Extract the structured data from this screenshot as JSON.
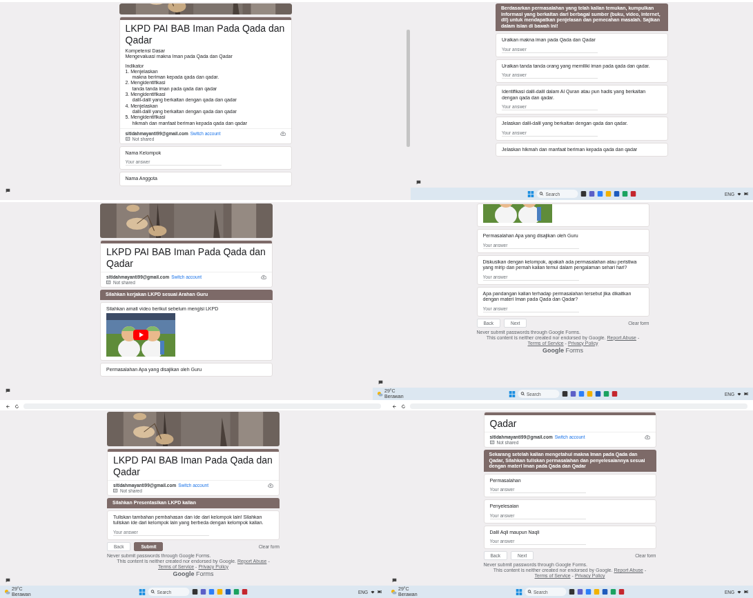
{
  "panels": [
    {
      "cards": [
        {
          "kind": "banner_strip"
        },
        {
          "kind": "title",
          "title": "LKPD PAI BAB Iman Pada Qada dan Qadar",
          "email": "sitidahmayanti99@gmail.com",
          "switch": "Switch account",
          "shared": "Not shared",
          "description": [
            {
              "kind": "line",
              "text": "Kompetensi Dasar"
            },
            {
              "kind": "line",
              "text": "Mengevaluasi makna Iman pada Qada dan Qadar"
            },
            {
              "kind": "gap"
            },
            {
              "kind": "line",
              "text": "Indikator"
            },
            {
              "kind": "line",
              "text": "1. Menjelaskan"
            },
            {
              "kind": "sub",
              "text": "makna beriman kepada qada dan qadar."
            },
            {
              "kind": "line",
              "text": "2. Mengidentifikasi"
            },
            {
              "kind": "sub",
              "text": "tanda tanda iman pada qada dan qadar"
            },
            {
              "kind": "line",
              "text": "3. Mengidentifikasi"
            },
            {
              "kind": "sub",
              "text": "dalil-dalil yang berkaitan dengan qada dan qadar"
            },
            {
              "kind": "line",
              "text": "4. Menjelaskan"
            },
            {
              "kind": "sub",
              "text": "dalil-dalil yang berkaitan dengan qada dan qadar"
            },
            {
              "kind": "line",
              "text": "5. Mengidentifikasi"
            },
            {
              "kind": "sub",
              "text": "hikmah dan manfaat beriman kepada qada dan qadar"
            }
          ]
        },
        {
          "kind": "question",
          "label": "Nama Kelompok",
          "placeholder": "Your answer"
        },
        {
          "kind": "question",
          "label": "Nama Anggota"
        }
      ]
    },
    {
      "taskbar": {
        "search": "Search",
        "lang": "ENG"
      },
      "cards": [
        {
          "kind": "section",
          "text": "Berdasarkan permasalahan yang telah kalian temukan, kumpulkan informasi yang berkaitan dari berbagai sumber (buku, video, internet, dll) untuk mendapatkan penjelasan dan pemecahan masalah. Sajikan dalam isian di bawah ini!"
        },
        {
          "kind": "question",
          "label": "Uraikan makna  iman pada Qada dan Qadar",
          "placeholder": "Your answer"
        },
        {
          "kind": "question",
          "label": "Uraikan tanda tanda orang yang memiliki iman pada qada dan qadar.",
          "placeholder": "Your answer"
        },
        {
          "kind": "question",
          "label": "Identifikasi dalil-dalil dalam Al Quran atau pun hadis yang berkaitan dengan qada dan qadar.",
          "placeholder": "Your answer"
        },
        {
          "kind": "question",
          "label": "Jelaskan dalil-dalil yang berkaitan dengan qada dan qadar.",
          "placeholder": "Your answer"
        },
        {
          "kind": "question",
          "label": "Jelaskan hikmah dan manfaat beriman kepada qada dan qadar"
        }
      ]
    },
    {
      "cards": [
        {
          "kind": "banner"
        },
        {
          "kind": "title",
          "title": "LKPD PAI BAB Iman Pada Qada dan Qadar",
          "email": "sitidahmayanti99@gmail.com",
          "switch": "Switch account",
          "shared": "Not shared"
        },
        {
          "kind": "section",
          "text": "Silahkan kerjakan LKPD sesuai Arahan Guru"
        },
        {
          "kind": "video",
          "text": "Silahkan amati video berikut sebelum mengisi LKPD"
        },
        {
          "kind": "question",
          "label": "Permasalahan Apa yang disajikan oleh Guru"
        }
      ]
    },
    {
      "taskbar": {
        "weather": {
          "temp": "29°C",
          "label": "Berawan"
        },
        "search": "Search",
        "lang": "ENG"
      },
      "cards": [
        {
          "kind": "video_tail"
        },
        {
          "kind": "question",
          "label": "Permasalahan Apa yang disajikan oleh Guru",
          "placeholder": "Your answer"
        },
        {
          "kind": "question",
          "label": "Diskusikan dengan kelompok, apakah ada permasalahan  atau peristiwa yang mirip dan pernah kalian temui dalam pengalaman sehari hari?",
          "placeholder": "Your answer"
        },
        {
          "kind": "question",
          "label": "Apa pandangan kalian terhadap permasalahan tersebut jika dikaitkan dengan materi Iman pada Qada dan Qadar?",
          "placeholder": "Your answer"
        },
        {
          "kind": "nav",
          "buttons": [
            {
              "label": "Back",
              "kind": "outline"
            },
            {
              "label": "Next",
              "kind": "outline"
            }
          ],
          "clear": "Clear form"
        },
        {
          "kind": "footer",
          "note": "Never submit passwords through Google Forms.",
          "disclaimer": "This content is neither created nor endorsed by Google.",
          "links": [
            "Report Abuse",
            "Terms of Service",
            "Privacy Policy"
          ],
          "separator": "-",
          "logo": {
            "brand": "Google",
            "product": "Forms"
          }
        }
      ]
    },
    {
      "top_bar": {
        "kind": "address"
      },
      "taskbar": {
        "weather": {
          "temp": "29°C",
          "label": "Berawan"
        },
        "search": "Search",
        "lang": "ENG"
      },
      "cards": [
        {
          "kind": "banner"
        },
        {
          "kind": "title",
          "title": "LKPD PAI BAB Iman Pada Qada dan Qadar",
          "email": "sitidahmayanti99@gmail.com",
          "switch": "Switch account",
          "shared": "Not shared"
        },
        {
          "kind": "section",
          "text": "Silahkan Presentasikan LKPD kalian"
        },
        {
          "kind": "question",
          "label": "Tuliskan tambahan pembahasan dan ide dari kelompok lain! Silahkan tuliskan ide dari kelompok lain yang berbeda dengan kelompok kalian.",
          "placeholder": "Your answer"
        },
        {
          "kind": "nav",
          "buttons": [
            {
              "label": "Back",
              "kind": "outline"
            },
            {
              "label": "Submit",
              "kind": "filled"
            }
          ],
          "clear": "Clear form"
        },
        {
          "kind": "footer",
          "note": "Never submit passwords through Google Forms.",
          "disclaimer": "This content is neither created nor endorsed by Google.",
          "links": [
            "Report Abuse",
            "Terms of Service",
            "Privacy Policy"
          ],
          "separator": "-",
          "logo": {
            "brand": "Google",
            "product": "Forms"
          }
        }
      ]
    },
    {
      "top_bar": {
        "kind": "address"
      },
      "taskbar": {
        "weather": {
          "temp": "29°C",
          "label": "Berawan"
        },
        "search": "Search",
        "lang": "ENG"
      },
      "cards": [
        {
          "kind": "title",
          "title": "Qadar",
          "email": "sitidahmayanti99@gmail.com",
          "switch": "Switch account",
          "shared": "Not shared"
        },
        {
          "kind": "section",
          "text": "Sekarang setelah kalian mengetahui makna Iman pada Qada dan Qadar, Silahkan tuliskan permasalahan dan penyelesaiannya sesuai dengan materi Iman pada Qada dan Qadar"
        },
        {
          "kind": "question",
          "label": "Permasalahan",
          "placeholder": "Your answer"
        },
        {
          "kind": "question",
          "label": "Penyelesaian",
          "placeholder": "Your answer"
        },
        {
          "kind": "question",
          "label": "Dalil Aqli maupun Naqli",
          "placeholder": "Your answer"
        },
        {
          "kind": "nav",
          "buttons": [
            {
              "label": "Back",
              "kind": "outline"
            },
            {
              "label": "Next",
              "kind": "outline"
            }
          ],
          "clear": "Clear form"
        },
        {
          "kind": "footer",
          "note": "Never submit passwords through Google Forms.",
          "disclaimer": "This content is neither created nor endorsed by Google.",
          "links": [
            "Report Abuse",
            "Terms of Service",
            "Privacy Policy"
          ],
          "separator": "-"
        }
      ]
    }
  ]
}
